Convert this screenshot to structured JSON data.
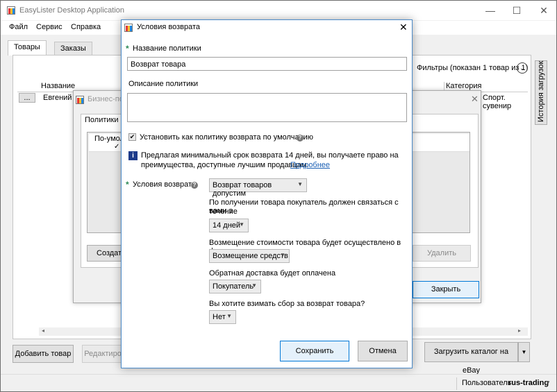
{
  "app": {
    "title": "EasyLister Desktop Application",
    "menu": [
      "Файл",
      "Сервис",
      "Справка"
    ],
    "tabs": [
      "Товары",
      "Заказы"
    ],
    "filters_label": "Фильтры (показан 1 товар из 1)",
    "side_tab": "История загрузок",
    "grid": {
      "columns": [
        "Название",
        "Категория"
      ],
      "row": {
        "ellipsis": "...",
        "name": "Евгений Н",
        "category": "Спорт. сувенир"
      }
    },
    "bottom_buttons": {
      "add": "Добавить товар",
      "edit": "Редактиро",
      "upload": "Загрузить каталог на eBay"
    },
    "status": {
      "user_label": "Пользователь",
      "user_name": "rus-trading"
    }
  },
  "bg_dialog": {
    "title": "Бизнес-пол",
    "group_label": "Политики о",
    "column": "По-умолч",
    "buttons": {
      "create": "Создат",
      "delete": "Удалить",
      "close": "Закрыть"
    }
  },
  "dialog": {
    "title": "Условия возврата",
    "policy_name_label": "Название политики",
    "policy_name_value": "Возврат товара",
    "policy_desc_label": "Описание политики",
    "policy_desc_value": "",
    "default_checkbox_label": "Установить как политику возврата по умолчанию",
    "default_checked": true,
    "info_text_line1": "Предлагая минимальный срок возврата 14 дней, вы получаете право на",
    "info_text_line2": "преимущества, доступные лучшим продавцам.",
    "info_link": "Подробнее",
    "return_conditions_label": "Условия возврата",
    "return_conditions_value": "Возврат товаров допустим",
    "contact_label_line1": "По получении товара покупатель должен связаться с вами в",
    "contact_label_line2": "течение",
    "contact_value": "14 дней",
    "refund_label": "Возмещение стоимости товара будет осуществлено в форме",
    "refund_value": "Возмещение средств",
    "shipping_label": "Обратная доставка будет оплачена",
    "shipping_value": "Покупатель",
    "fee_label": "Вы хотите взимать сбор за возврат товара?",
    "fee_value": "Нет",
    "save": "Сохранить",
    "cancel": "Отмена"
  }
}
